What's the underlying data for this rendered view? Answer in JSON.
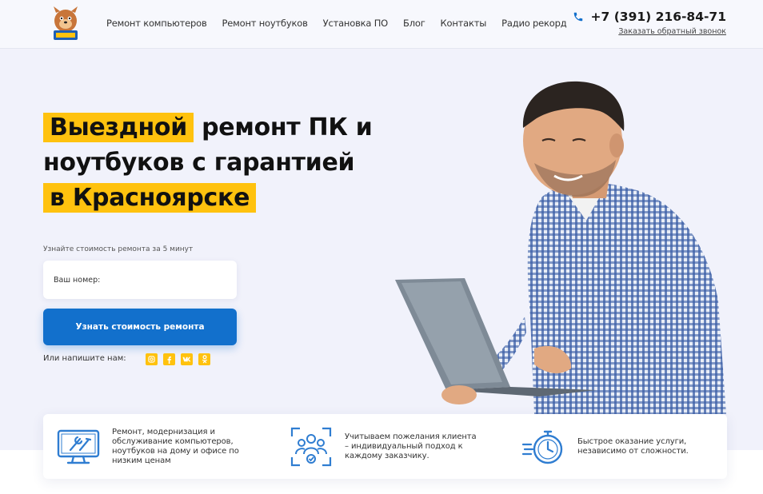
{
  "header": {
    "nav": [
      "Ремонт компьютеров",
      "Ремонт ноутбуков",
      "Установка ПО",
      "Блог",
      "Контакты",
      "Радио рекорд"
    ],
    "phone": "+7 (391) 216-84-71",
    "callback": "Заказать обратный звонок"
  },
  "hero": {
    "title_l1_hl": "Выездной",
    "title_l1_rest": "ремонт ПК и",
    "title_l2": "ноутбуков с гарантией",
    "title_l3_hl": "в Красноярске",
    "subtitle": "Узнайте стоимость ремонта за 5 минут",
    "phone_placeholder": "Ваш номер:",
    "cta": "Узнать стоимость ремонта",
    "write_us": "Или напишите нам:"
  },
  "socials": [
    "instagram-icon",
    "facebook-icon",
    "vk-icon",
    "odnoklassniki-icon"
  ],
  "features": [
    {
      "icon": "monitor-tools-icon",
      "text": "Ремонт, модернизация и обслуживание компьютеров, ноутбуков на дому и офисе по низким ценам"
    },
    {
      "icon": "client-focus-icon",
      "text": "Учитываем пожелания клиента – индивидуальный подход к каждому заказчику."
    },
    {
      "icon": "stopwatch-icon",
      "text": "Быстрое оказание услуги, независимо от сложности."
    }
  ],
  "colors": {
    "accent": "#ffc20e",
    "primary": "#1270cc",
    "background": "#f1f2fb"
  }
}
